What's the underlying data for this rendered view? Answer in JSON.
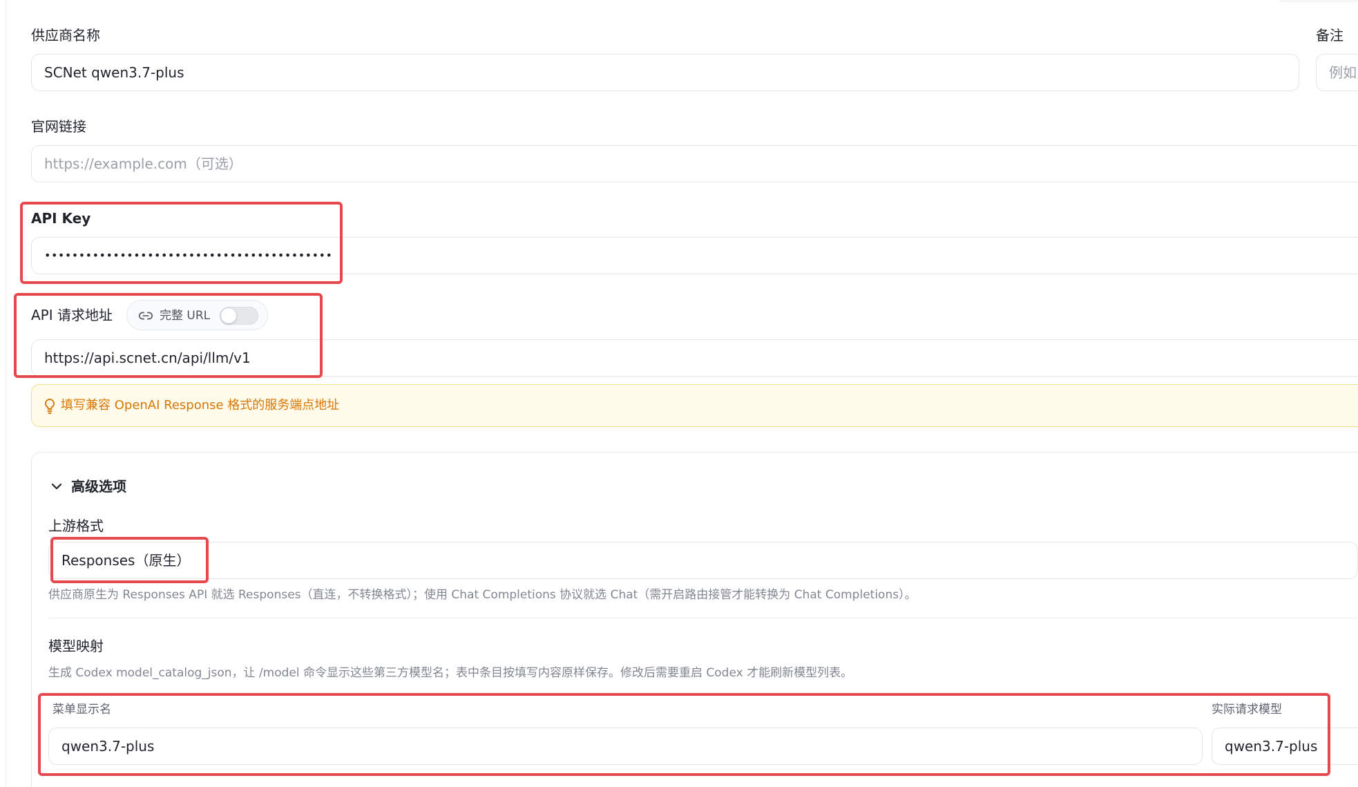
{
  "provider": {
    "name_label": "供应商名称",
    "name_value": "SCNet qwen3.7-plus",
    "note_label": "备注",
    "note_placeholder": "例如"
  },
  "website": {
    "label": "官网链接",
    "placeholder": "https://example.com（可选）"
  },
  "api_key": {
    "label": "API Key",
    "masked_value": "••••••••••••••••••••••••••••••••••••••••••"
  },
  "api_url": {
    "label": "API 请求地址",
    "full_url_toggle_label": "完整 URL",
    "full_url_enabled": false,
    "value": "https://api.scnet.cn/api/llm/v1"
  },
  "tip": {
    "text": "填写兼容 OpenAI Response 格式的服务端点地址",
    "icon": "lightbulb-icon"
  },
  "advanced": {
    "title": "高级选项",
    "expanded": true,
    "upstream_format": {
      "label": "上游格式",
      "value": "Responses（原生）",
      "hint": "供应商原生为 Responses API 就选 Responses（直连，不转换格式）；使用 Chat Completions 协议就选 Chat（需开启路由接管才能转换为 Chat Completions）。"
    },
    "model_mapping": {
      "label": "模型映射",
      "hint": "生成 Codex model_catalog_json，让 /model 命令显示这些第三方模型名；表中条目按填写内容原样保存。修改后需要重启 Codex 才能刷新模型列表。",
      "menu_name_header": "菜单显示名",
      "actual_model_header": "实际请求模型",
      "rows": [
        {
          "menu_name": "qwen3.7-plus",
          "actual_model": "qwen3.7-plus"
        }
      ]
    }
  },
  "colors": {
    "highlight": "#e5484d",
    "tip_text": "#d97706",
    "tip_background": "#fffbea"
  }
}
